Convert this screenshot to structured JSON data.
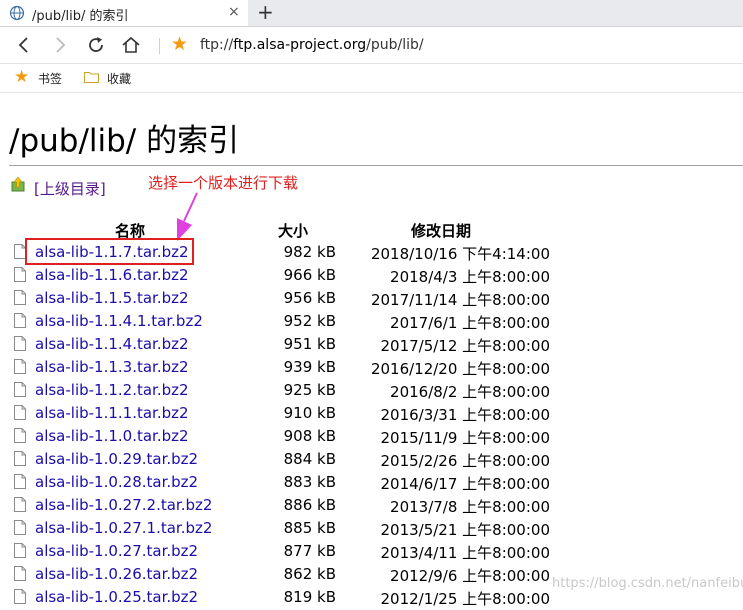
{
  "browser": {
    "tab_title": "/pub/lib/ 的索引",
    "tab_close": "×",
    "new_tab": "+",
    "url_scheme": "ftp://",
    "url_host": "ftp.alsa-project.org",
    "url_path": "/pub/lib/",
    "bookmarks": [
      {
        "label": "书签",
        "icon": "star-icon"
      },
      {
        "label": "收藏",
        "icon": "folder-icon"
      }
    ]
  },
  "page": {
    "title": "/pub/lib/ 的索引",
    "parent_link": "[上级目录]",
    "annotation": "选择一个版本进行下载",
    "headers": {
      "name": "名称",
      "size": "大小",
      "modified": "修改日期"
    },
    "files": [
      {
        "name": "alsa-lib-1.1.7.tar.bz2",
        "size": "982 kB",
        "date": "2018/10/16 下午4:14:00"
      },
      {
        "name": "alsa-lib-1.1.6.tar.bz2",
        "size": "966 kB",
        "date": "2018/4/3 上午8:00:00"
      },
      {
        "name": "alsa-lib-1.1.5.tar.bz2",
        "size": "956 kB",
        "date": "2017/11/14 上午8:00:00"
      },
      {
        "name": "alsa-lib-1.1.4.1.tar.bz2",
        "size": "952 kB",
        "date": "2017/6/1 上午8:00:00"
      },
      {
        "name": "alsa-lib-1.1.4.tar.bz2",
        "size": "951 kB",
        "date": "2017/5/12 上午8:00:00"
      },
      {
        "name": "alsa-lib-1.1.3.tar.bz2",
        "size": "939 kB",
        "date": "2016/12/20 上午8:00:00"
      },
      {
        "name": "alsa-lib-1.1.2.tar.bz2",
        "size": "925 kB",
        "date": "2016/8/2 上午8:00:00"
      },
      {
        "name": "alsa-lib-1.1.1.tar.bz2",
        "size": "910 kB",
        "date": "2016/3/31 上午8:00:00"
      },
      {
        "name": "alsa-lib-1.1.0.tar.bz2",
        "size": "908 kB",
        "date": "2015/11/9 上午8:00:00"
      },
      {
        "name": "alsa-lib-1.0.29.tar.bz2",
        "size": "884 kB",
        "date": "2015/2/26 上午8:00:00"
      },
      {
        "name": "alsa-lib-1.0.28.tar.bz2",
        "size": "883 kB",
        "date": "2014/6/17 上午8:00:00"
      },
      {
        "name": "alsa-lib-1.0.27.2.tar.bz2",
        "size": "886 kB",
        "date": "2013/7/8 上午8:00:00"
      },
      {
        "name": "alsa-lib-1.0.27.1.tar.bz2",
        "size": "885 kB",
        "date": "2013/5/21 上午8:00:00"
      },
      {
        "name": "alsa-lib-1.0.27.tar.bz2",
        "size": "877 kB",
        "date": "2013/4/11 上午8:00:00"
      },
      {
        "name": "alsa-lib-1.0.26.tar.bz2",
        "size": "862 kB",
        "date": "2012/9/6 上午8:00:00"
      },
      {
        "name": "alsa-lib-1.0.25.tar.bz2",
        "size": "819 kB",
        "date": "2012/1/25 上午8:00:00"
      }
    ]
  },
  "watermark": "https://blog.csdn.net/nanfeibuyi",
  "colors": {
    "link": "#1a0dab",
    "visited": "#551a8b",
    "annotation": "#e02020",
    "arrow": "#e040e0",
    "star": "#f39c12"
  }
}
